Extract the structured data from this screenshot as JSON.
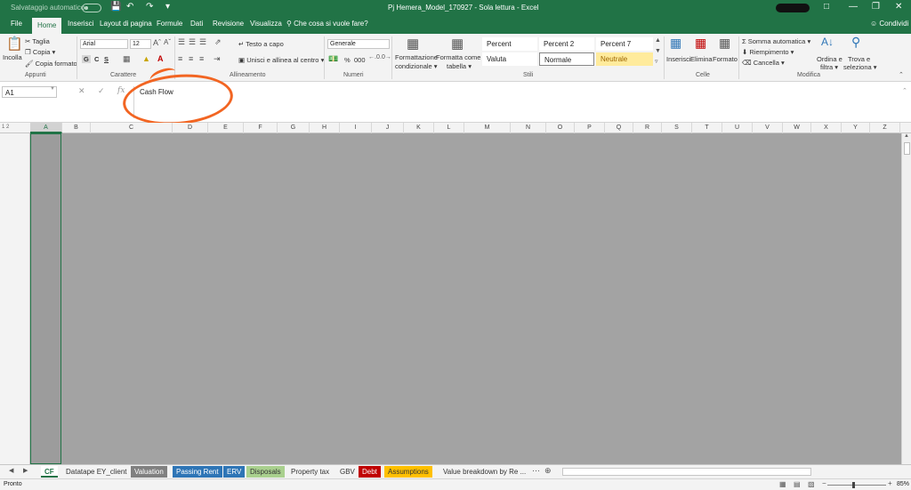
{
  "titlebar": {
    "autosave": "Salvataggio automatico",
    "title": "Pj Hemera_Model_170927  -  Sola lettura  -  Excel"
  },
  "tabs": [
    "File",
    "Home",
    "Inserisci",
    "Layout di pagina",
    "Formule",
    "Dati",
    "Revisione",
    "Visualizza"
  ],
  "tell_me": "Che cosa si vuole fare?",
  "share": "Condividi",
  "ribbon": {
    "paste": "Incolla",
    "cut": "Taglia",
    "copy": "Copia",
    "format_painter": "Copia formato",
    "font_name": "Arial",
    "font_size": "12",
    "bold": "G",
    "italic": "C",
    "underline": "S",
    "wrap": "Testo a capo",
    "merge": "Unisci e allinea al centro",
    "number_format": "Generale",
    "percent": "%",
    "thousands": "000",
    "cond_format_1": "Formattazione",
    "cond_format_2": "condizionale",
    "format_table_1": "Formatta come",
    "format_table_2": "tabella",
    "styles": [
      "Percent",
      "Percent 2",
      "Percent 7",
      "Valuta",
      "Normale",
      "Neutrale"
    ],
    "insert": "Inserisci",
    "delete": "Elimina",
    "format": "Formato",
    "autosum": "Somma automatica",
    "fill": "Riempimento",
    "clear": "Cancella",
    "sort_1": "Ordina e",
    "sort_2": "filtra",
    "find_1": "Trova e",
    "find_2": "seleziona",
    "groups": [
      "Appunti",
      "Carattere",
      "Allineamento",
      "Numeri",
      "Stili",
      "Celle",
      "Modifica"
    ]
  },
  "formula_bar": {
    "cell_ref": "A1",
    "content": "Cash Flow"
  },
  "columns": [
    "A",
    "B",
    "C",
    "D",
    "E",
    "F",
    "G",
    "H",
    "I",
    "J",
    "K",
    "L",
    "M",
    "N",
    "O",
    "P",
    "Q",
    "R",
    "S",
    "T",
    "U",
    "V",
    "W",
    "X",
    "Y",
    "Z"
  ],
  "sheets": [
    "CF",
    "Datatape EY_client",
    "Valuation",
    "Passing Rent",
    "ERV",
    "Disposals",
    "Property tax",
    "GBV",
    "Debt",
    "Assumptions",
    "Value breakdown by Re ..."
  ],
  "sheet_colors": {
    "Valuation": "#808080",
    "Passing Rent": "#2e75b6",
    "ERV": "#2e75b6",
    "Disposals": "#a9d08e",
    "Debt": "#c00000",
    "Assumptions": "#ffc000"
  },
  "status": {
    "ready": "Pronto",
    "zoom": "85%"
  },
  "colors": {
    "accent": "#217346",
    "annotation": "#f26522"
  }
}
